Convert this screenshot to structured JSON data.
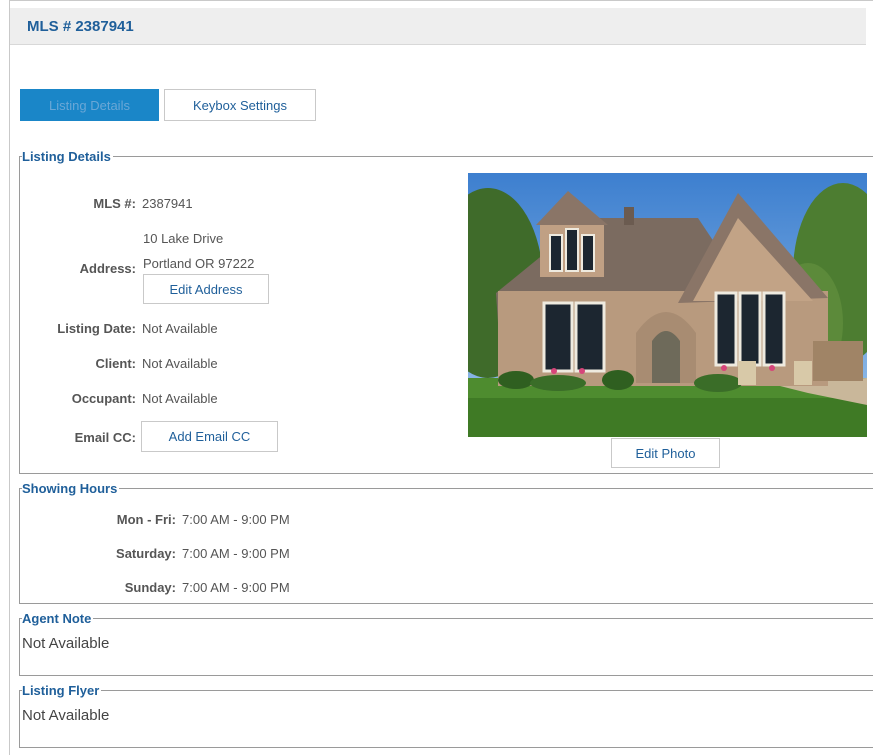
{
  "header": {
    "title": "MLS # 2387941"
  },
  "tabs": [
    {
      "label": "Listing Details",
      "active": true
    },
    {
      "label": "Keybox Settings",
      "active": false
    }
  ],
  "listing_details": {
    "legend": "Listing Details",
    "mls_label": "MLS #:",
    "mls_value": "2387941",
    "address_label": "Address:",
    "address_line1": "10 Lake Drive",
    "address_line2": "Portland OR 97222",
    "edit_address_label": "Edit Address",
    "listing_date_label": "Listing Date:",
    "listing_date_value": "Not Available",
    "client_label": "Client:",
    "client_value": "Not Available",
    "occupant_label": "Occupant:",
    "occupant_value": "Not Available",
    "email_cc_label": "Email CC:",
    "add_email_cc_label": "Add Email CC",
    "edit_photo_label": "Edit Photo"
  },
  "showing_hours": {
    "legend": "Showing Hours",
    "rows": [
      {
        "day": "Mon - Fri:",
        "hours": "7:00 AM - 9:00 PM"
      },
      {
        "day": "Saturday:",
        "hours": "7:00 AM - 9:00 PM"
      },
      {
        "day": "Sunday:",
        "hours": "7:00 AM - 9:00 PM"
      }
    ]
  },
  "agent_note": {
    "legend": "Agent Note",
    "text": "Not Available"
  },
  "listing_flyer": {
    "legend": "Listing Flyer",
    "text": "Not Available"
  },
  "colors": {
    "accent": "#1f5f9a",
    "tab_active_bg": "#1a86c8",
    "header_bg": "#eeeeee"
  }
}
